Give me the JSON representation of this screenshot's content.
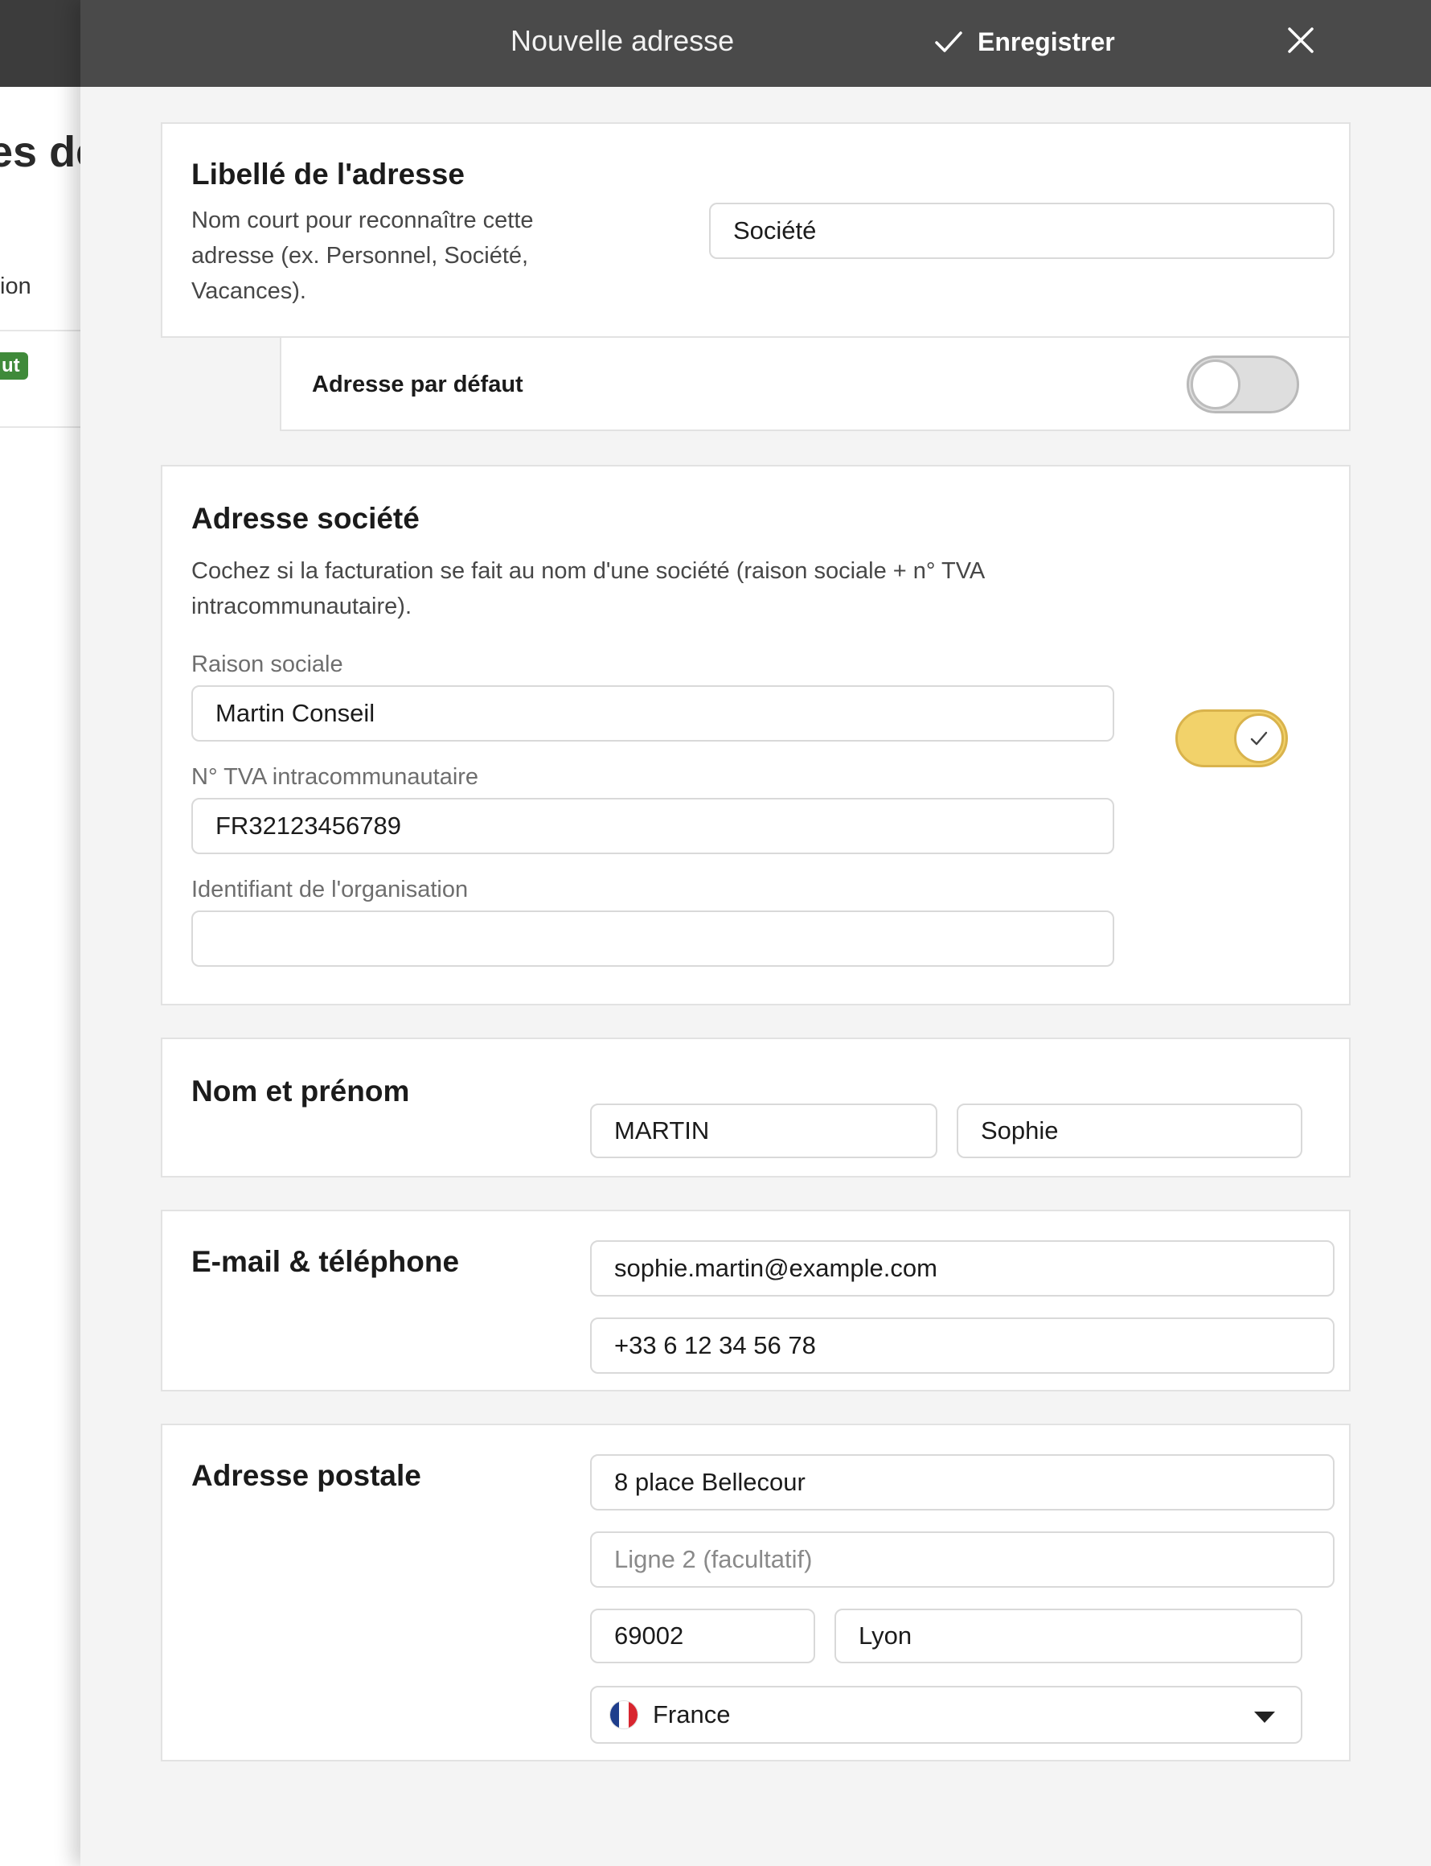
{
  "background": {
    "title_fragment": "es de",
    "item_fragment": "ion",
    "badge_fragment": "ut"
  },
  "header": {
    "title": "Nouvelle adresse",
    "save_label": "Enregistrer",
    "save_icon": "check-icon",
    "close_icon": "close-icon"
  },
  "label_section": {
    "title": "Libellé de l'adresse",
    "description": "Nom court pour reconnaître cette adresse (ex. Personnel, Société, Vacances).",
    "value": "Société",
    "default_label": "Adresse par défaut",
    "default_on": false
  },
  "company_section": {
    "title": "Adresse société",
    "description": "Cochez si la facturation se fait au nom d'une société (raison sociale + n° TVA intracommunautaire).",
    "company_name_label": "Raison sociale",
    "company_name_value": "Martin Conseil",
    "vat_label": "N° TVA intracommunautaire",
    "vat_value": "FR32123456789",
    "org_id_label": "Identifiant de l'organisation",
    "org_id_value": "",
    "enabled": true
  },
  "name_section": {
    "title": "Nom et prénom",
    "last_name": "MARTIN",
    "first_name": "Sophie"
  },
  "contact_section": {
    "title": "E-mail & téléphone",
    "email": "sophie.martin@example.com",
    "phone": "+33 6 12 34 56 78"
  },
  "postal_section": {
    "title": "Adresse postale",
    "line1": "8 place Bellecour",
    "line2_placeholder": "Ligne 2 (facultatif)",
    "zip": "69002",
    "city": "Lyon",
    "country": "France",
    "country_flag": "flag-fr-icon"
  },
  "colors": {
    "header_bg": "#4a4a4a",
    "toggle_on": "#f2d26a",
    "badge_green": "#3f8a3a"
  }
}
